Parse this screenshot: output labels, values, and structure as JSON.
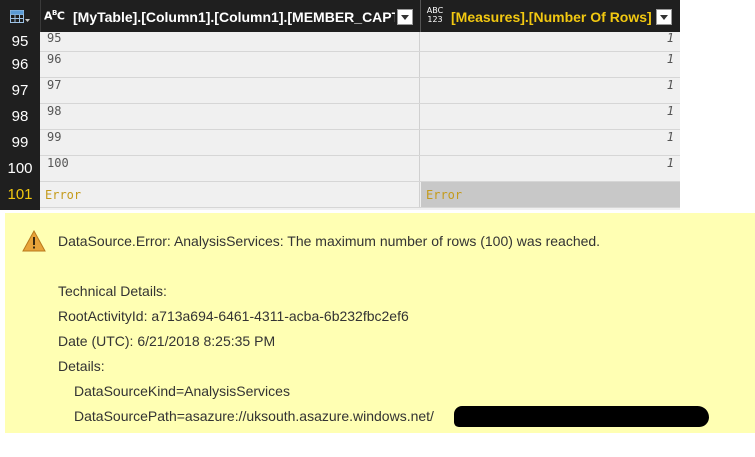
{
  "grid": {
    "columns": [
      {
        "type_icon": "text-type-icon",
        "title": "[MyTable].[Column1].[Column1].[MEMBER_CAPT...",
        "dropdown_icon": "chevron-down-icon"
      },
      {
        "type_icon": "any-type-icon",
        "type_icon_text_top": "ABC",
        "type_icon_text_bottom": "123",
        "title": "[Measures].[Number Of Rows]",
        "dropdown_icon": "chevron-down-icon"
      }
    ],
    "rows": [
      {
        "num": "95",
        "col1": "95",
        "col2": "1"
      },
      {
        "num": "96",
        "col1": "96",
        "col2": "1"
      },
      {
        "num": "97",
        "col1": "97",
        "col2": "1"
      },
      {
        "num": "98",
        "col1": "98",
        "col2": "1"
      },
      {
        "num": "99",
        "col1": "99",
        "col2": "1"
      },
      {
        "num": "100",
        "col1": "100",
        "col2": "1"
      },
      {
        "num": "101",
        "col1": "Error",
        "col2": "Error"
      }
    ],
    "header_text_color": "#ffffff",
    "measure_header_color": "#f2c811",
    "error_color": "#c49a1a"
  },
  "error_panel": {
    "icon": "warning-icon",
    "title": "DataSource.Error: AnalysisServices: The maximum number of rows (100) was reached.",
    "technical_details_label": "Technical Details:",
    "root_activity": "RootActivityId: a713a694-6461-4311-acba-6b232fbc2ef6",
    "date": "Date (UTC): 6/21/2018 8:25:35 PM",
    "details_label": "Details:",
    "datasource_kind": "DataSourceKind=AnalysisServices",
    "datasource_path": "DataSourcePath=asazure://uksouth.asazure.windows.net/",
    "background": "#ffffb3"
  }
}
